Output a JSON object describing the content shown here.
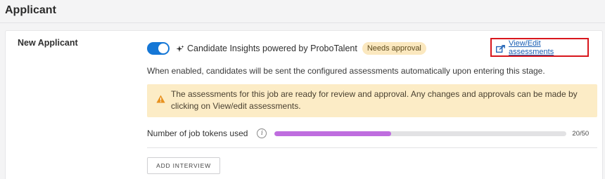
{
  "section": {
    "title": "Applicant"
  },
  "stage": {
    "name": "New Applicant",
    "toggle_on": true,
    "insights_label": "Candidate Insights powered by ProboTalent",
    "badge": "Needs approval",
    "view_edit_label": "View/Edit assessments",
    "description": "When enabled, candidates will be sent the configured assessments automatically upon entering this stage.",
    "alert": {
      "line1": "The assessments for this job are ready for review and approval. Any changes and approvals can be made by",
      "line2": "clicking on View/edit assessments."
    },
    "tokens": {
      "label": "Number of job tokens used",
      "used": 20,
      "total": 50,
      "count_text": "20/50"
    },
    "add_interview_label": "ADD INTERVIEW"
  },
  "colors": {
    "toggle": "#1577d6",
    "badge_bg": "#fbe8bf",
    "alert_bg": "#fcecc6",
    "progress_fill": "#bf6ddf",
    "highlight_border": "#d8161c",
    "link": "#1a5fb4"
  },
  "icons": [
    "sparkle-icon",
    "external-link-icon",
    "warning-icon",
    "info-icon"
  ]
}
